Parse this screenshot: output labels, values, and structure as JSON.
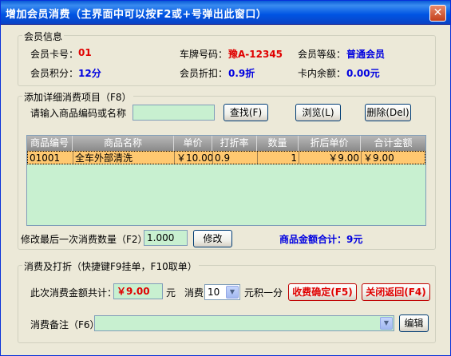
{
  "window": {
    "title": "增加会员消费（主界面中可以按F2或+号弹出此窗口）"
  },
  "member_info": {
    "legend": "会员信息",
    "card_no_label": "会员卡号：",
    "card_no": "01",
    "plate_label": "车牌号码：",
    "plate": "豫A-12345",
    "level_label": "会员等级：",
    "level": "普通会员",
    "points_label": "会员积分：",
    "points": "12分",
    "discount_label": "会员折扣：",
    "discount": "0.9折",
    "balance_label": "卡内余额：",
    "balance": "0.00元"
  },
  "add_items": {
    "legend": "添加详细消费项目（F8）",
    "search_label": "请输入商品编码或名称",
    "search_value": "",
    "find_button": "查找(F)",
    "browse_button": "浏览(L)",
    "delete_button": "删除(Del)",
    "columns": [
      "商品编号",
      "商品名称",
      "单价",
      "打折率",
      "数量",
      "折后单价",
      "合计金额"
    ],
    "rows": [
      [
        "01001",
        "全车外部清洗",
        "￥10.00",
        "0.9",
        "1",
        "￥9.00",
        "￥9.00"
      ]
    ],
    "modify_label": "修改最后一次消费数量（F2）:",
    "modify_value": "1.000",
    "modify_button": "修改",
    "total_text": "商品金额合计：9元"
  },
  "checkout": {
    "legend": "消费及打折（快捷键F9挂单，F10取单）",
    "amount_label": "此次消费金额共计：",
    "amount": "￥9.00",
    "yuan": "元",
    "spend_label": "消费",
    "spend_value": "10",
    "points_rule": "元积一分",
    "confirm_button": "收费确定(F5)",
    "close_button": "关闭返回(F4)",
    "remark_label": "消费备注（F6）:",
    "remark_value": "",
    "edit_button": "编辑"
  }
}
